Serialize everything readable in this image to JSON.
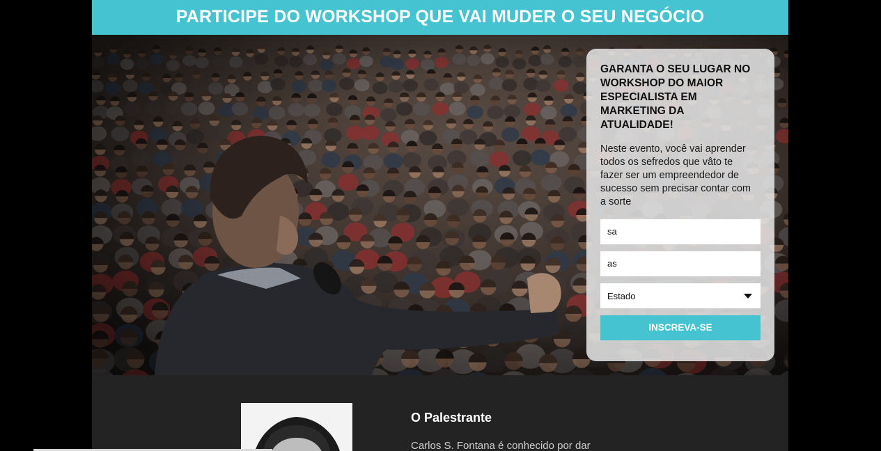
{
  "header": {
    "title": "PARTICIPE DO WORKSHOP QUE VAI MUDER O SEU NEGÓCIO"
  },
  "colors": {
    "accent": "#46c3d0",
    "dark_section": "#222322",
    "background": "#000000"
  },
  "signup_card": {
    "title": "GARANTA O SEU LUGAR NO WORKSHOP DO MAIOR ESPECIALISTA EM MARKETING DA ATUALIDADE!",
    "description": "Neste evento, você vai aprender todos os sefredos que vâto te fazer ser um empreendedor de sucesso sem precisar contar com a sorte",
    "field1_value": "sa",
    "field2_value": "as",
    "state_select_value": "Estado",
    "submit_label": "INSCREVA-SE"
  },
  "speaker": {
    "heading": "O Palestrante",
    "bio": "Carlos S. Fontana é conhecido por dar"
  },
  "icons": {
    "select_caret": "caret-down-icon"
  }
}
